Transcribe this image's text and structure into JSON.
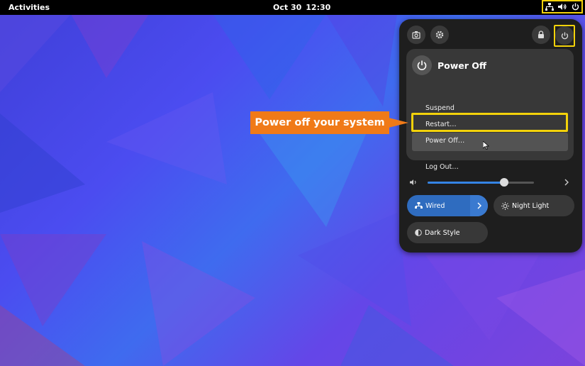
{
  "topbar": {
    "activities": "Activities",
    "date": "Oct 30",
    "time": "12:30",
    "tray_icons": [
      "network-wired-icon",
      "volume-icon",
      "power-icon"
    ]
  },
  "panel": {
    "top_buttons": [
      "screenshot-icon",
      "settings-icon",
      "lock-icon",
      "power-icon"
    ],
    "power_menu": {
      "title": "Power Off",
      "items": [
        "Suspend",
        "Restart…",
        "Power Off…",
        "Log Out…"
      ],
      "highlighted": "Power Off…"
    },
    "volume": {
      "level": 0.72
    },
    "quick_settings": {
      "wired": "Wired",
      "night_light": "Night Light",
      "dark_style": "Dark Style"
    }
  },
  "annotation": {
    "callout": "Power off your system",
    "color": "#f07a18",
    "highlight_color": "#f3d20a"
  }
}
